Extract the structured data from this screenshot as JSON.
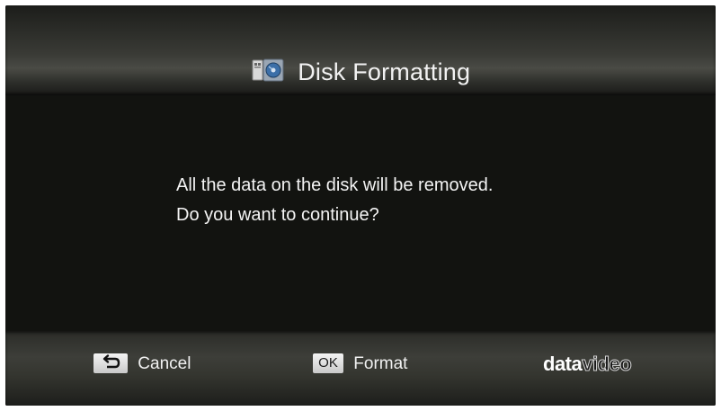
{
  "dialog": {
    "title": "Disk Formatting",
    "title_icon": "disk-format-icon",
    "message_line1": "All the data on the disk will be removed.",
    "message_line2": "Do you want to continue?"
  },
  "footer": {
    "cancel": {
      "key_icon": "back-arrow-icon",
      "label": "Cancel"
    },
    "format": {
      "key_label": "OK",
      "label": "Format"
    },
    "brand": {
      "part1": "data",
      "part2": "video"
    }
  },
  "colors": {
    "background": "#121310",
    "text": "#f4f4f4",
    "key": "#e6e6e6"
  }
}
